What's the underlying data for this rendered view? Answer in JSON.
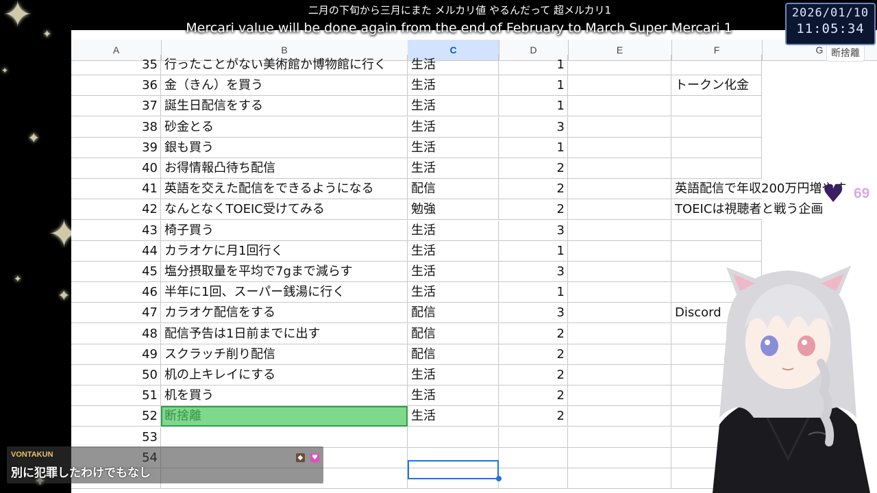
{
  "subtitle": {
    "jp": "二月の下旬から三月にまた メルカリ値 やるんだって 超メルカリ1",
    "en": "Mercari value will be done again from the end of February to March Super Mercari 1"
  },
  "clock": {
    "date": "2026/01/10",
    "time": "11:05:34"
  },
  "columns": [
    "A",
    "B",
    "C",
    "D",
    "E",
    "F",
    "G"
  ],
  "selected_column": "C",
  "right_snippet": "断捨離",
  "rows": [
    {
      "n": "35",
      "b": "行ったことがない美術館か博物館に行く",
      "c": "生活",
      "d": "1",
      "f": ""
    },
    {
      "n": "36",
      "b": "金（きん）を買う",
      "c": "生活",
      "d": "1",
      "f": "トークン化金"
    },
    {
      "n": "37",
      "b": "誕生日配信をする",
      "c": "生活",
      "d": "1",
      "f": ""
    },
    {
      "n": "38",
      "b": "砂金とる",
      "c": "生活",
      "d": "3",
      "f": ""
    },
    {
      "n": "39",
      "b": "銀も買う",
      "c": "生活",
      "d": "1",
      "f": ""
    },
    {
      "n": "40",
      "b": "お得情報凸待ち配信",
      "c": "生活",
      "d": "2",
      "f": ""
    },
    {
      "n": "41",
      "b": "英語を交えた配信をできるようになる",
      "c": "配信",
      "d": "2",
      "f": "英語配信で年収200万円増やす"
    },
    {
      "n": "42",
      "b": "なんとなくTOEIC受けてみる",
      "c": "勉強",
      "d": "2",
      "f": "TOEICは視聴者と戦う企画"
    },
    {
      "n": "43",
      "b": "椅子買う",
      "c": "生活",
      "d": "3",
      "f": ""
    },
    {
      "n": "44",
      "b": "カラオケに月1回行く",
      "c": "生活",
      "d": "1",
      "f": ""
    },
    {
      "n": "45",
      "b": "塩分摂取量を平均で7gまで減らす",
      "c": "生活",
      "d": "3",
      "f": ""
    },
    {
      "n": "46",
      "b": "半年に1回、スーパー銭湯に行く",
      "c": "生活",
      "d": "1",
      "f": ""
    },
    {
      "n": "47",
      "b": "カラオケ配信をする",
      "c": "配信",
      "d": "3",
      "f": "Discord"
    },
    {
      "n": "48",
      "b": "配信予告は1日前までに出す",
      "c": "配信",
      "d": "2",
      "f": ""
    },
    {
      "n": "49",
      "b": "スクラッチ削り配信",
      "c": "配信",
      "d": "2",
      "f": ""
    },
    {
      "n": "50",
      "b": "机の上キレイにする",
      "c": "生活",
      "d": "2",
      "f": ""
    },
    {
      "n": "51",
      "b": "机を買う",
      "c": "生活",
      "d": "2",
      "f": ""
    },
    {
      "n": "52",
      "b": "断捨離",
      "c": "生活",
      "d": "2",
      "f": ""
    },
    {
      "n": "53",
      "b": "",
      "c": "",
      "d": "",
      "f": ""
    },
    {
      "n": "54",
      "b": "",
      "c": "",
      "d": "",
      "f": ""
    },
    {
      "n": "",
      "b": "",
      "c": "",
      "d": "",
      "f": ""
    }
  ],
  "heart_count": "69",
  "chat": {
    "user": "VONTAKUN",
    "message": "別に犯罪したわけでもなし"
  }
}
